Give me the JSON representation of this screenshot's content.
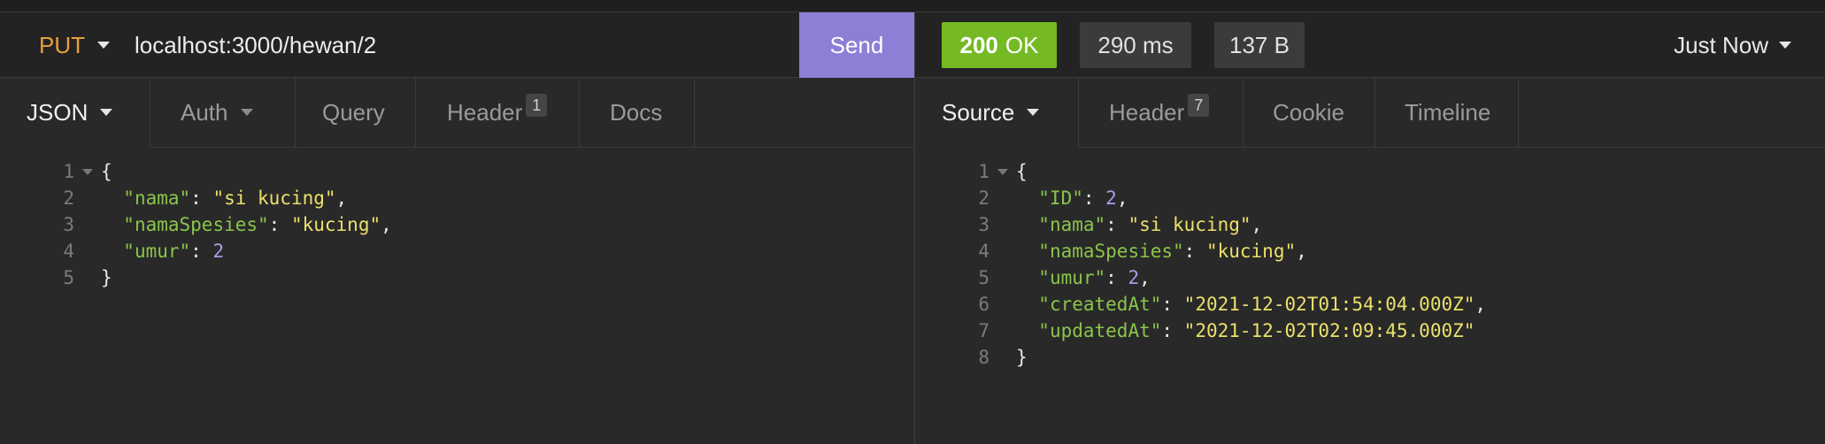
{
  "request": {
    "method": "PUT",
    "url": "localhost:3000/hewan/2",
    "send_label": "Send",
    "tabs": [
      {
        "label": "JSON",
        "has_caret": true
      },
      {
        "label": "Auth",
        "has_caret": true
      },
      {
        "label": "Query"
      },
      {
        "label": "Header",
        "count": "1"
      },
      {
        "label": "Docs"
      }
    ],
    "body_lines": [
      {
        "num": "1",
        "text": "{"
      },
      {
        "num": "2",
        "key": "\"nama\"",
        "value": "\"si kucing\"",
        "trail": ","
      },
      {
        "num": "3",
        "key": "\"namaSpesies\"",
        "value": "\"kucing\"",
        "trail": ","
      },
      {
        "num": "4",
        "key": "\"umur\"",
        "value": "2",
        "trail": ""
      },
      {
        "num": "5",
        "text": "}"
      }
    ]
  },
  "response": {
    "status_code": "200",
    "status_text": "OK",
    "time": "290 ms",
    "size": "137 B",
    "when": "Just Now",
    "tabs": [
      {
        "label": "Source",
        "has_caret": true
      },
      {
        "label": "Header",
        "count": "7"
      },
      {
        "label": "Cookie"
      },
      {
        "label": "Timeline"
      }
    ],
    "body_lines": [
      {
        "num": "1",
        "text": "{"
      },
      {
        "num": "2",
        "key": "\"ID\"",
        "value": "2",
        "trail": ","
      },
      {
        "num": "3",
        "key": "\"nama\"",
        "value": "\"si kucing\"",
        "trail": ","
      },
      {
        "num": "4",
        "key": "\"namaSpesies\"",
        "value": "\"kucing\"",
        "trail": ","
      },
      {
        "num": "5",
        "key": "\"umur\"",
        "value": "2",
        "trail": ","
      },
      {
        "num": "6",
        "key": "\"createdAt\"",
        "value": "\"2021-12-02T01:54:04.000Z\"",
        "trail": ","
      },
      {
        "num": "7",
        "key": "\"updatedAt\"",
        "value": "\"2021-12-02T02:09:45.000Z\"",
        "trail": ""
      },
      {
        "num": "8",
        "text": "}"
      }
    ]
  },
  "colors": {
    "method": "#e8a03a",
    "send_button": "#8c7fd6",
    "status_ok": "#75ba24",
    "json_key": "#8ac54a",
    "json_string": "#ebe06a",
    "json_number": "#a99be8"
  }
}
